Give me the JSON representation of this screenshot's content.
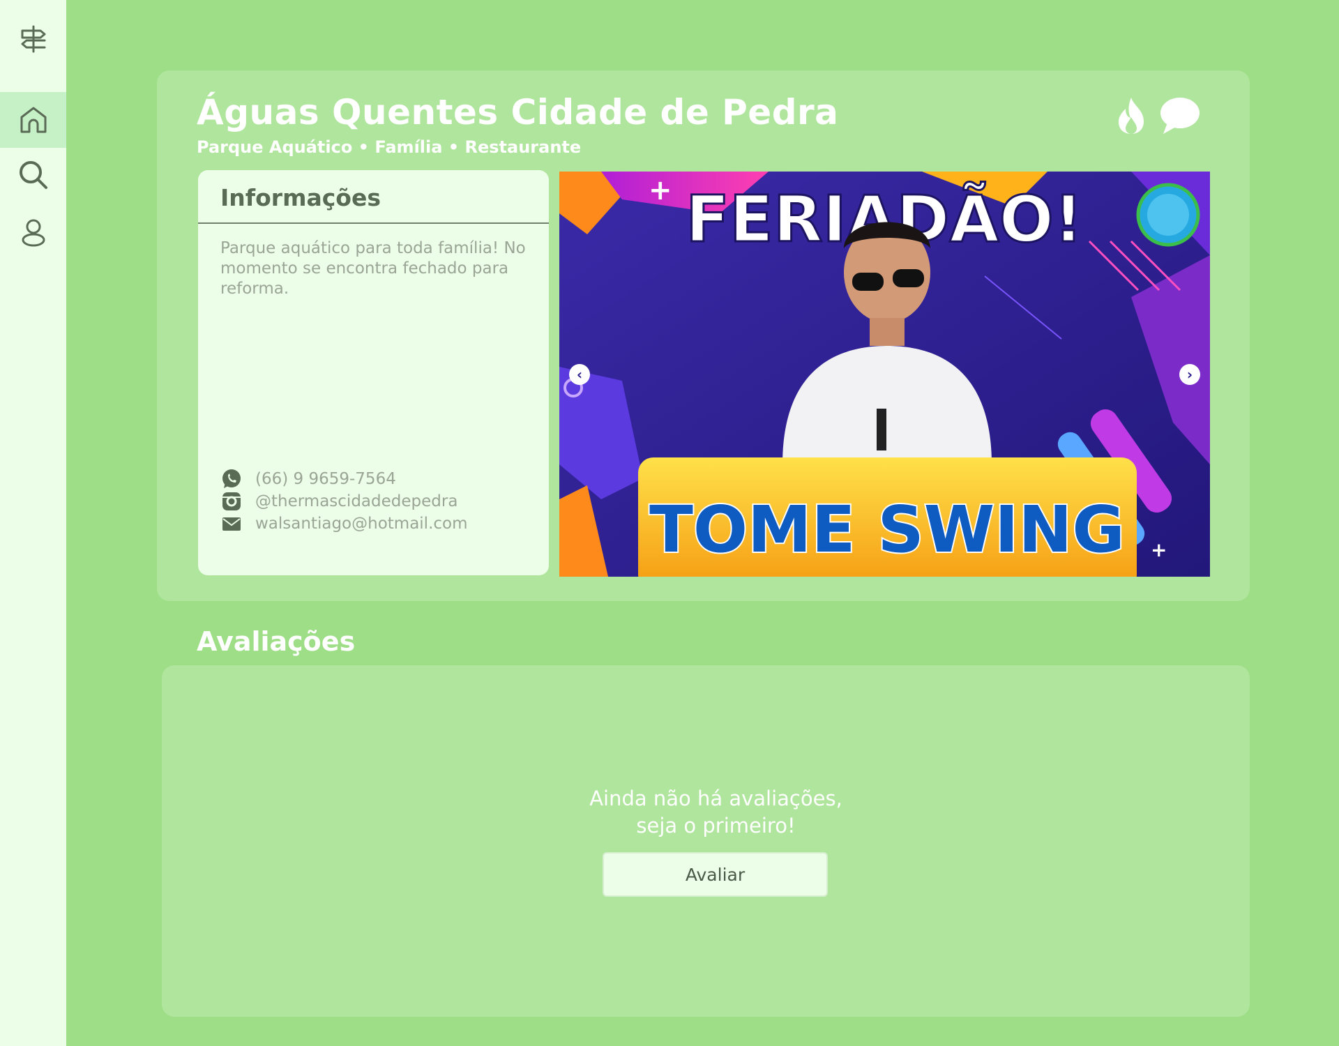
{
  "sidebar": {
    "items": [
      {
        "icon": "signpost-icon"
      },
      {
        "icon": "home-icon",
        "active": true
      },
      {
        "icon": "search-icon"
      },
      {
        "icon": "user-icon"
      }
    ]
  },
  "place": {
    "title": "Águas Quentes Cidade de Pedra",
    "subtitle": "Parque Aquático • Família • Restaurante",
    "actions": [
      {
        "icon": "fire-icon"
      },
      {
        "icon": "chat-bubble-icon"
      }
    ]
  },
  "info": {
    "heading": "Informações",
    "description": "Parque aquático para toda família! No momento se encontra fechado para reforma.",
    "contacts": {
      "phone": "(66) 9 9659-7564",
      "instagram": "@thermascidadedepedra",
      "email": "walsantiago@hotmail.com"
    }
  },
  "carousel": {
    "banner_headline": "FERIADÃO!",
    "banner_footer": "TOME SWING",
    "prev_label": "‹",
    "next_label": "›"
  },
  "reviews": {
    "title": "Avaliações",
    "empty_line1": "Ainda não há avaliações,",
    "empty_line2": "seja o primeiro!",
    "button_label": "Avaliar"
  },
  "colors": {
    "background": "#9ede86",
    "card": "#b0e59d",
    "sidebar": "#ecfde8",
    "active_item": "#c6f0c6"
  }
}
